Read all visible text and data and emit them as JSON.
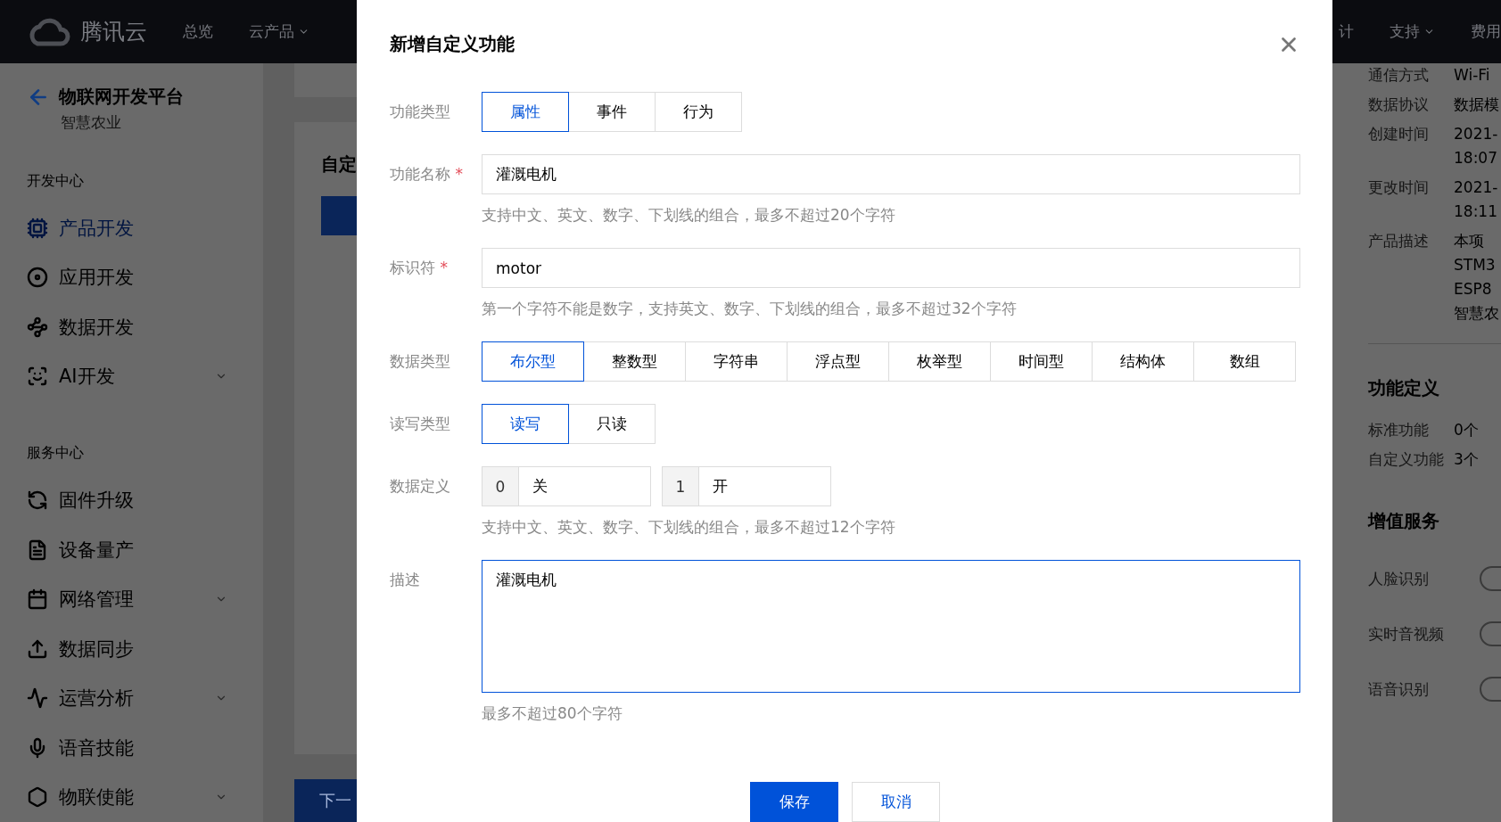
{
  "topbar": {
    "brand": "腾讯云",
    "nav": [
      {
        "label": "总览",
        "dropdown": false
      },
      {
        "label": "云产品",
        "dropdown": true
      }
    ],
    "right_nav": [
      {
        "label": "计",
        "dropdown": false
      },
      {
        "label": "支持",
        "dropdown": true
      },
      {
        "label": "费用",
        "dropdown": false
      }
    ]
  },
  "sidebar": {
    "back_title": "物联网开发平台",
    "subtitle": "智慧农业",
    "sections": [
      {
        "title": "开发中心",
        "items": [
          {
            "label": "产品开发",
            "selected": true,
            "expandable": false
          },
          {
            "label": "应用开发",
            "selected": false,
            "expandable": false
          },
          {
            "label": "数据开发",
            "selected": false,
            "expandable": false
          },
          {
            "label": "AI开发",
            "selected": false,
            "expandable": true
          }
        ]
      },
      {
        "title": "服务中心",
        "items": [
          {
            "label": "固件升级",
            "selected": false,
            "expandable": false
          },
          {
            "label": "设备量产",
            "selected": false,
            "expandable": false
          },
          {
            "label": "网络管理",
            "selected": false,
            "expandable": true
          },
          {
            "label": "数据同步",
            "selected": false,
            "expandable": false
          },
          {
            "label": "运营分析",
            "selected": false,
            "expandable": true
          },
          {
            "label": "语音技能",
            "selected": false,
            "expandable": false
          },
          {
            "label": "物联使能",
            "selected": false,
            "expandable": true
          }
        ]
      }
    ]
  },
  "content": {
    "card_title": "自定",
    "next_button": "下一"
  },
  "info_panel": {
    "rows": [
      {
        "label": "通信方式",
        "value": [
          "Wi-Fi"
        ]
      },
      {
        "label": "数据协议",
        "value": [
          "数据模"
        ]
      },
      {
        "label": "创建时间",
        "value": [
          "2021-",
          "18:07"
        ]
      },
      {
        "label": "更改时间",
        "value": [
          "2021-",
          "18:11"
        ]
      },
      {
        "label": "产品描述",
        "value": [
          "本项",
          "STM3",
          "ESP8",
          "智慧农"
        ]
      }
    ],
    "function_title": "功能定义",
    "function_rows": [
      {
        "label": "标准功能",
        "value": "0个"
      },
      {
        "label": "自定义功能",
        "value": "3个"
      }
    ],
    "services_title": "增值服务",
    "services": [
      {
        "label": "人脸识别",
        "on": false
      },
      {
        "label": "实时音视频",
        "on": false
      },
      {
        "label": "语音识别",
        "on": false
      }
    ]
  },
  "dialog": {
    "title": "新增自定义功能",
    "fields": [
      {
        "kind": "segments",
        "label": "功能类型",
        "options": [
          {
            "label": "属性",
            "selected": true
          },
          {
            "label": "事件",
            "selected": false
          },
          {
            "label": "行为",
            "selected": false
          }
        ]
      },
      {
        "kind": "input",
        "label": "功能名称",
        "required_mark": "*",
        "value": "灌溉电机",
        "help": "支持中文、英文、数字、下划线的组合，最多不超过20个字符"
      },
      {
        "kind": "input",
        "label": "标识符",
        "required_mark": "*",
        "value": "motor",
        "help": "第一个字符不能是数字，支持英文、数字、下划线的组合，最多不超过32个字符"
      },
      {
        "kind": "segments",
        "label": "数据类型",
        "options": [
          {
            "label": "布尔型",
            "selected": true
          },
          {
            "label": "整数型",
            "selected": false
          },
          {
            "label": "字符串",
            "selected": false
          },
          {
            "label": "浮点型",
            "selected": false
          },
          {
            "label": "枚举型",
            "selected": false
          },
          {
            "label": "时间型",
            "selected": false
          },
          {
            "label": "结构体",
            "selected": false
          },
          {
            "label": "数组",
            "selected": false
          }
        ]
      },
      {
        "kind": "segments",
        "label": "读写类型",
        "options": [
          {
            "label": "读写",
            "selected": true
          },
          {
            "label": "只读",
            "selected": false
          }
        ]
      },
      {
        "kind": "pairs",
        "label": "数据定义",
        "pairs": [
          {
            "key": "0",
            "value": "关"
          },
          {
            "key": "1",
            "value": "开"
          }
        ],
        "help": "支持中文、英文、数字、下划线的组合，最多不超过12个字符"
      },
      {
        "kind": "textarea",
        "label": "描述",
        "value": "灌溉电机",
        "help": "最多不超过80个字符"
      }
    ],
    "buttons": [
      {
        "label": "保存",
        "primary": true
      },
      {
        "label": "取消",
        "primary": false
      }
    ]
  }
}
